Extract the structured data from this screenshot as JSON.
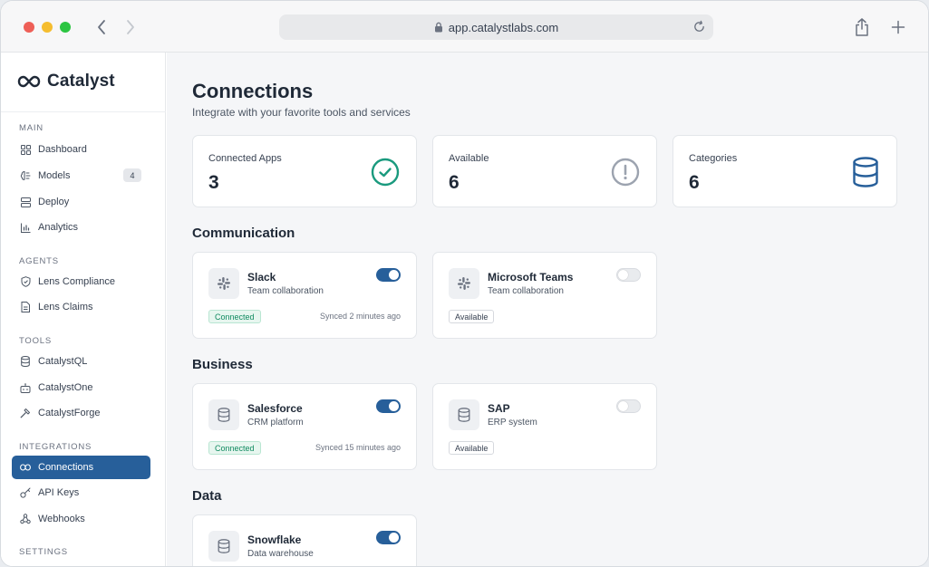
{
  "browser": {
    "url": "app.catalystlabs.com"
  },
  "sidebar": {
    "brand": "Catalyst",
    "sections": {
      "main": "MAIN",
      "agents": "AGENTS",
      "tools": "TOOLS",
      "integrations": "INTEGRATIONS",
      "settings": "SETTINGS"
    },
    "items": {
      "dashboard": "Dashboard",
      "models": "Models",
      "models_badge": "4",
      "deploy": "Deploy",
      "analytics": "Analytics",
      "lens_compliance": "Lens Compliance",
      "lens_claims": "Lens Claims",
      "catalystql": "CatalystQL",
      "catalystone": "CatalystOne",
      "catalystforge": "CatalystForge",
      "connections": "Connections",
      "api_keys": "API Keys",
      "webhooks": "Webhooks"
    }
  },
  "page": {
    "title": "Connections",
    "subtitle": "Integrate with your favorite tools and services"
  },
  "stats": {
    "connected": {
      "label": "Connected Apps",
      "value": "3"
    },
    "available": {
      "label": "Available",
      "value": "6"
    },
    "categories": {
      "label": "Categories",
      "value": "6"
    }
  },
  "groups": {
    "communication": "Communication",
    "business": "Business",
    "data": "Data"
  },
  "connections": {
    "slack": {
      "name": "Slack",
      "desc": "Team collaboration",
      "status": "Connected",
      "sync": "Synced 2 minutes ago",
      "enabled": true
    },
    "teams": {
      "name": "Microsoft Teams",
      "desc": "Team collaboration",
      "status": "Available",
      "enabled": false
    },
    "salesforce": {
      "name": "Salesforce",
      "desc": "CRM platform",
      "status": "Connected",
      "sync": "Synced 15 minutes ago",
      "enabled": true
    },
    "sap": {
      "name": "SAP",
      "desc": "ERP system",
      "status": "Available",
      "enabled": false
    },
    "snowflake": {
      "name": "Snowflake",
      "desc": "Data warehouse",
      "enabled": true
    }
  },
  "colors": {
    "accent": "#275f9a",
    "success": "#1a9a7e",
    "neutral": "#9ca3af"
  }
}
